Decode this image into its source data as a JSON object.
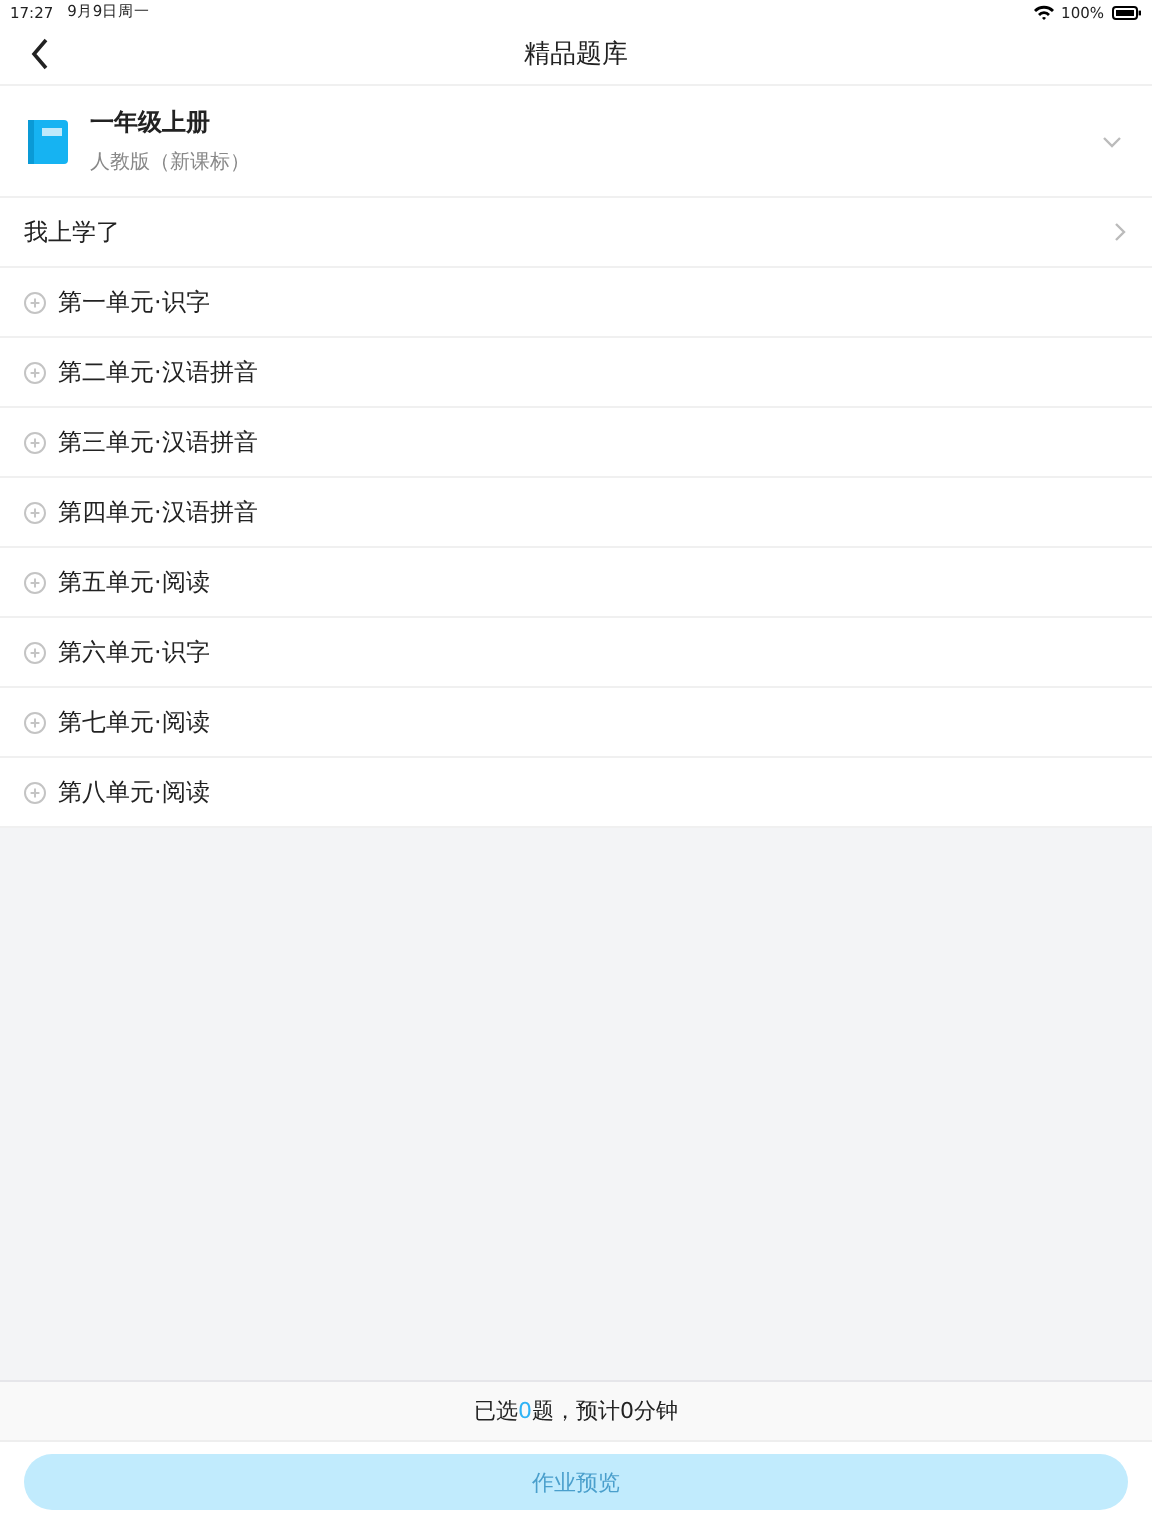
{
  "status_bar": {
    "time": "17:27",
    "date": "9月9日周一",
    "battery": "100%"
  },
  "nav": {
    "title": "精品题库"
  },
  "book": {
    "title": "一年级上册",
    "edition": "人教版（新课标）"
  },
  "learned": {
    "label": "我上学了"
  },
  "units": [
    {
      "label": "第一单元·识字"
    },
    {
      "label": "第二单元·汉语拼音"
    },
    {
      "label": "第三单元·汉语拼音"
    },
    {
      "label": "第四单元·汉语拼音"
    },
    {
      "label": "第五单元·阅读"
    },
    {
      "label": "第六单元·识字"
    },
    {
      "label": "第七单元·阅读"
    },
    {
      "label": "第八单元·阅读"
    }
  ],
  "summary": {
    "prefix": "已选",
    "count": "0",
    "suffix": "题，预计0分钟"
  },
  "preview_button": {
    "label": "作业预览",
    "disabled": true
  }
}
